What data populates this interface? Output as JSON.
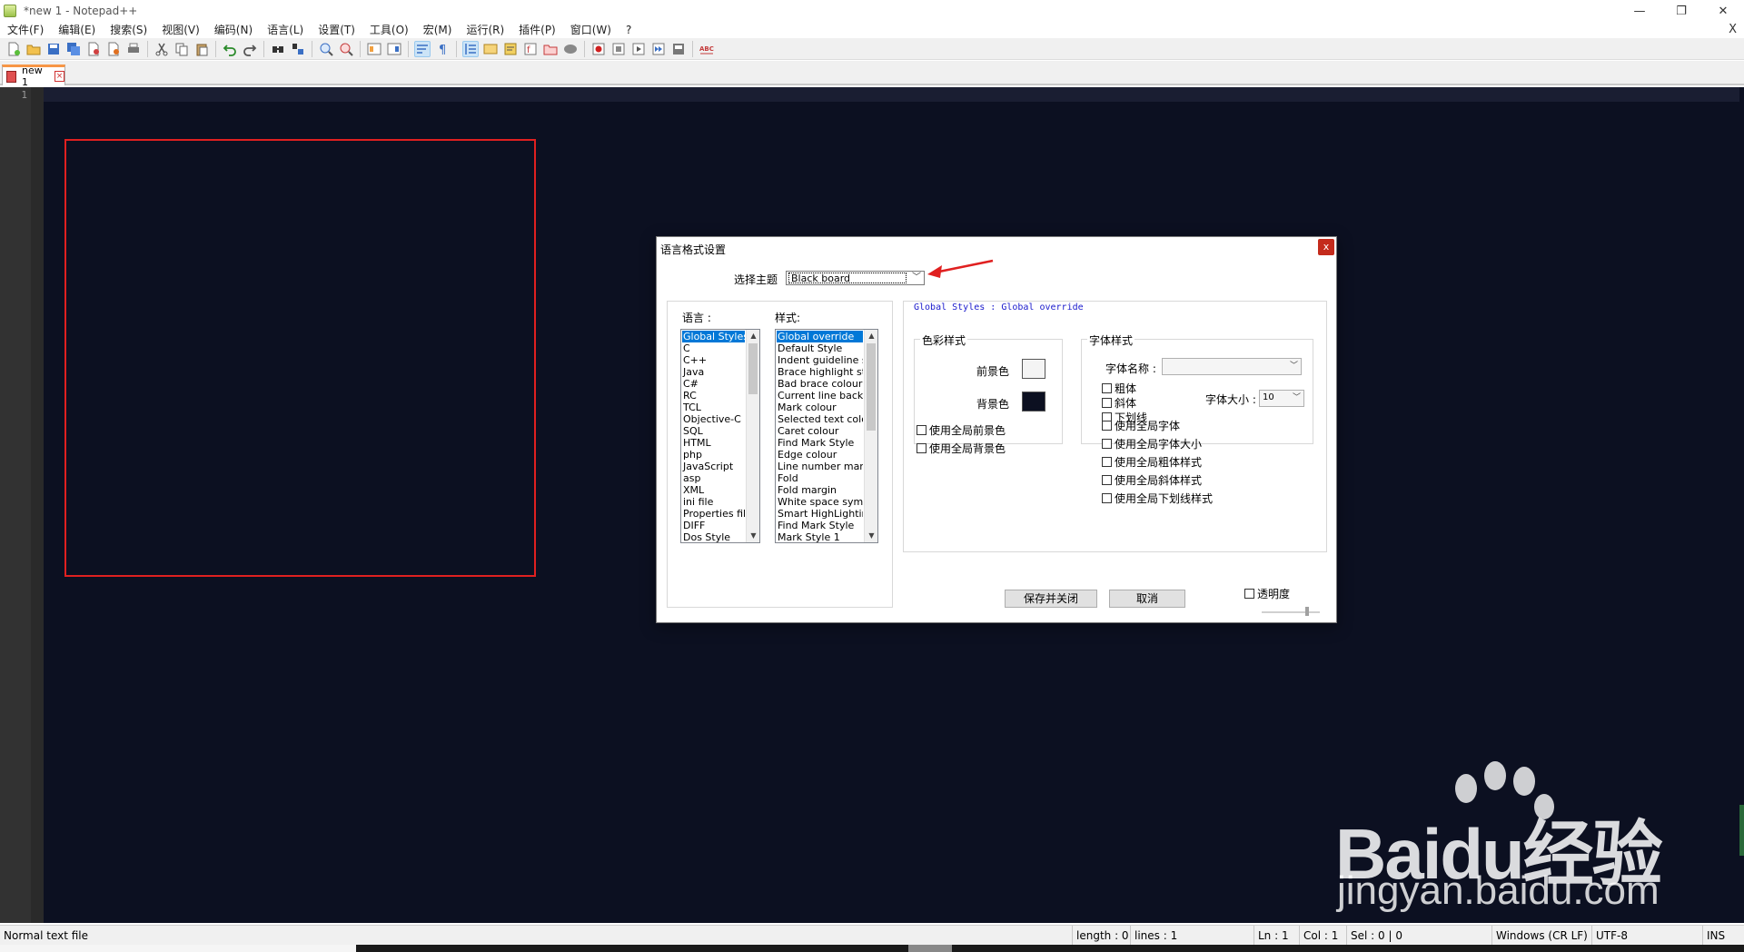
{
  "window": {
    "title": "*new 1 - Notepad++",
    "minimize_glyph": "—",
    "restore_glyph": "❐",
    "close_glyph": "✕"
  },
  "menu": {
    "items": [
      "文件(F)",
      "编辑(E)",
      "搜索(S)",
      "视图(V)",
      "编码(N)",
      "语言(L)",
      "设置(T)",
      "工具(O)",
      "宏(M)",
      "运行(R)",
      "插件(P)",
      "窗口(W)",
      "?"
    ],
    "close_glyph": "X"
  },
  "toolbar": {
    "icons": [
      "new-file-icon",
      "open-file-icon",
      "save-icon",
      "save-all-icon",
      "close-icon",
      "close-all-icon",
      "print-icon",
      "cut-icon",
      "copy-icon",
      "paste-icon",
      "undo-icon",
      "redo-icon",
      "find-icon",
      "replace-icon",
      "zoom-in-icon",
      "zoom-out-icon",
      "sync-v-icon",
      "sync-h-icon",
      "wrap-icon",
      "show-all-chars-icon",
      "indent-guide-icon",
      "udl-icon",
      "doc-map-icon",
      "function-list-icon",
      "folder-workspace-icon",
      "monitor-icon",
      "record-macro-icon",
      "stop-record-icon",
      "play-macro-icon",
      "play-multi-icon",
      "save-macro-icon",
      "spellcheck-icon"
    ],
    "spellcheck_label": "ABC"
  },
  "tab": {
    "label": "new 1",
    "close_glyph": "×"
  },
  "editor": {
    "line_number": "1",
    "background": "#0c1021"
  },
  "status": {
    "file_type": "Normal text file",
    "length": "length : 0",
    "lines": "lines : 1",
    "ln": "Ln : 1",
    "col": "Col : 1",
    "sel": "Sel : 0 | 0",
    "eol": "Windows (CR LF)",
    "encoding": "UTF-8",
    "mode": "INS"
  },
  "dialog": {
    "title": "语言格式设置",
    "close_glyph": "x",
    "theme_label": "选择主题",
    "theme_value": "Black board",
    "language_label": "语言 :",
    "style_label": "样式:",
    "languages": [
      "Global Styles",
      "C",
      "C++",
      "Java",
      "C#",
      "RC",
      "TCL",
      "Objective-C",
      "SQL",
      "HTML",
      "php",
      "JavaScript",
      "asp",
      "XML",
      "ini file",
      "Properties file",
      "DIFF",
      "Dos Style"
    ],
    "styles": [
      "Global override",
      "Default Style",
      "Indent guideline style",
      "Brace highlight style",
      "Bad brace colour",
      "Current line background",
      "Mark colour",
      "Selected text colour",
      "Caret colour",
      "Find Mark Style",
      "Edge colour",
      "Line number margin",
      "Fold",
      "Fold margin",
      "White space symbol",
      "Smart HighLighting",
      "Find Mark Style",
      "Mark Style 1"
    ],
    "style_description": "Global Styles : Global override",
    "color_group": "色彩样式",
    "foreground_label": "前景色",
    "background_label": "背景色",
    "foreground_color": "#f4f4f4",
    "background_color": "#0c1021",
    "font_group": "字体样式",
    "font_name_label": "字体名称 :",
    "font_name_value": "",
    "bold": "粗体",
    "italic": "斜体",
    "underline": "下划线",
    "font_size_label": "字体大小 :",
    "font_size_value": "10",
    "use_global_fg": "使用全局前景色",
    "use_global_bg": "使用全局背景色",
    "use_global_font": "使用全局字体",
    "use_global_size": "使用全局字体大小",
    "use_global_bold": "使用全局粗体样式",
    "use_global_italic": "使用全局斜体样式",
    "use_global_underline": "使用全局下划线样式",
    "save_button": "保存并关闭",
    "cancel_button": "取消",
    "transparency": "透明度"
  },
  "watermark": {
    "brand": "Baidu经验",
    "url": "jingyan.baidu.com"
  }
}
